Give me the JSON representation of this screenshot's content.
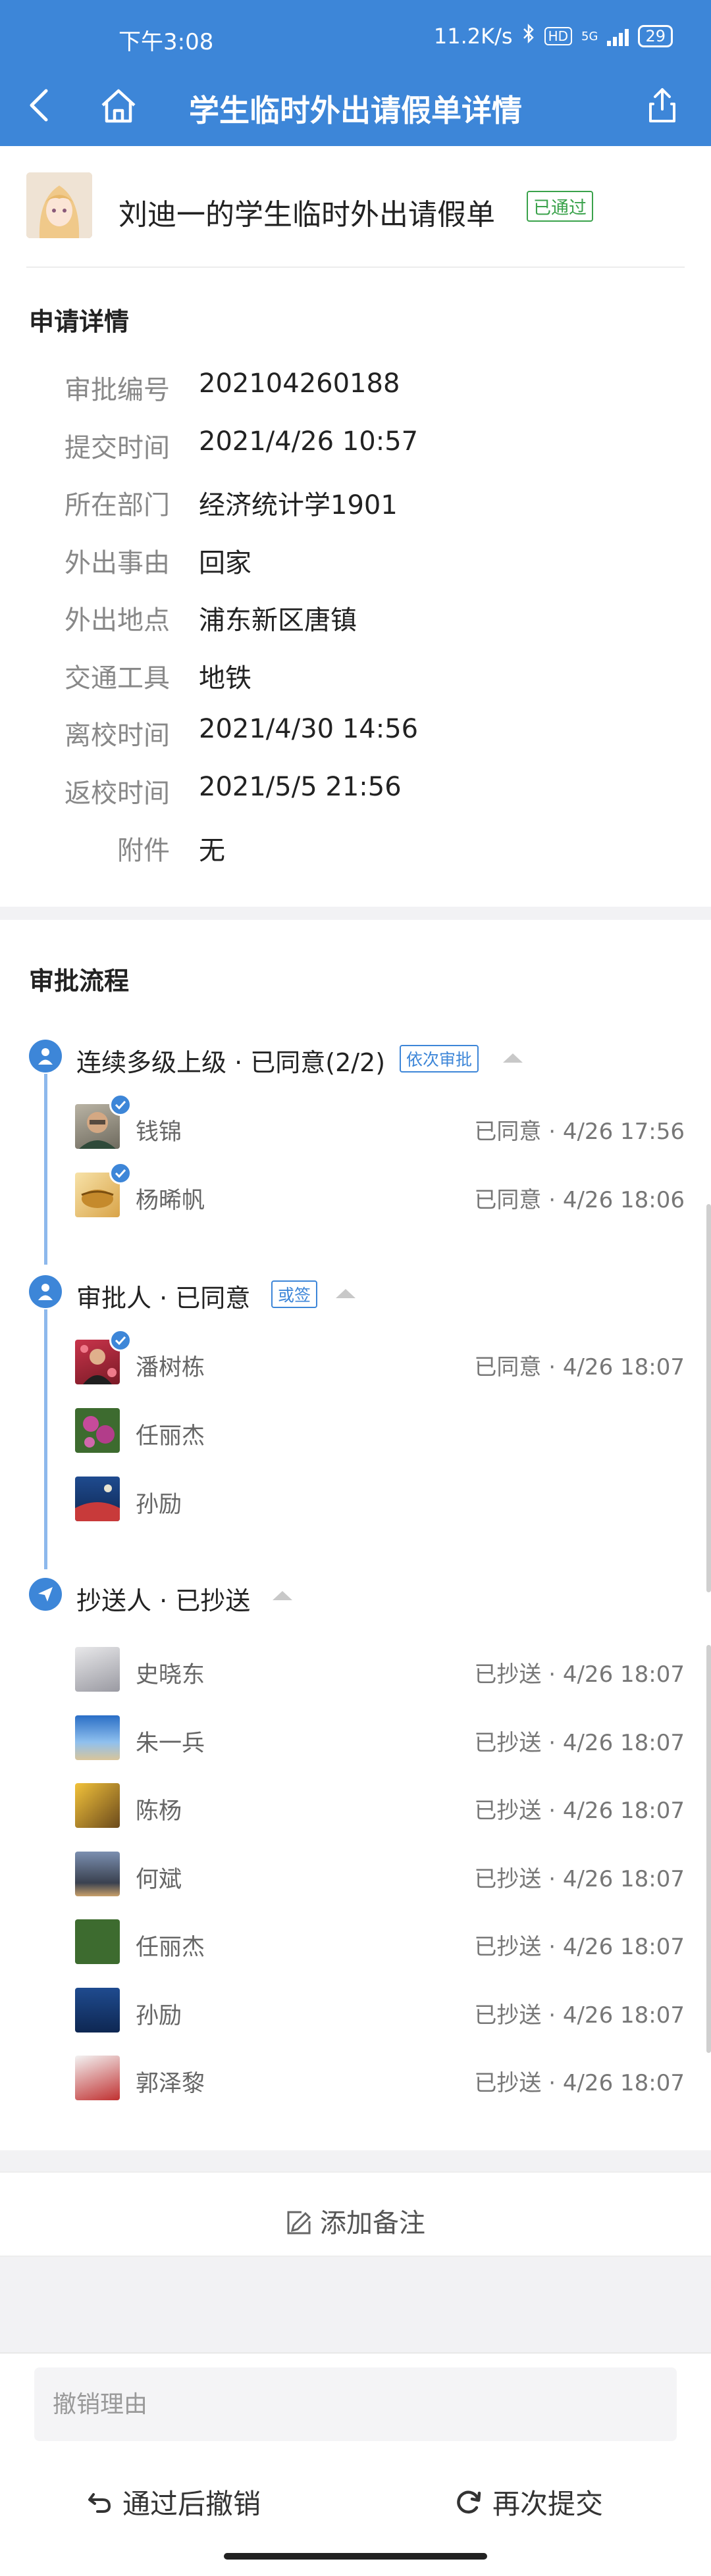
{
  "status_bar": {
    "time": "下午3:08",
    "network": "11.2K/s",
    "hd": "HD",
    "net_type": "5G",
    "battery": "29"
  },
  "header": {
    "title": "学生临时外出请假单详情"
  },
  "request": {
    "title": "刘迪一的学生临时外出请假单",
    "badge": "已通过"
  },
  "details": {
    "section_title": "申请详情",
    "rows": [
      {
        "label": "审批编号",
        "value": "202104260188"
      },
      {
        "label": "提交时间",
        "value": "2021/4/26 10:57"
      },
      {
        "label": "所在部门",
        "value": "经济统计学1901"
      },
      {
        "label": "外出事由",
        "value": "回家"
      },
      {
        "label": "外出地点",
        "value": "浦东新区唐镇"
      },
      {
        "label": "交通工具",
        "value": "地铁"
      },
      {
        "label": "离校时间",
        "value": "2021/4/30 14:56"
      },
      {
        "label": "返校时间",
        "value": "2021/5/5 21:56"
      },
      {
        "label": "附件",
        "value": "无"
      }
    ]
  },
  "flow": {
    "section_title": "审批流程",
    "steps": [
      {
        "title": "连续多级上级 · 已同意(2/2)",
        "tag": "依次审批",
        "icon": "person-icon",
        "people": [
          {
            "name": "钱锦",
            "status": "已同意 · 4/26 17:56",
            "checked": true
          },
          {
            "name": "杨晞帆",
            "status": "已同意 · 4/26 18:06",
            "checked": true
          }
        ]
      },
      {
        "title": "审批人 · 已同意",
        "tag": "或签",
        "icon": "person-icon",
        "people": [
          {
            "name": "潘树栋",
            "status": "已同意 · 4/26 18:07",
            "checked": true
          },
          {
            "name": "任丽杰",
            "status": "",
            "checked": false
          },
          {
            "name": "孙励",
            "status": "",
            "checked": false
          }
        ]
      },
      {
        "title": "抄送人 · 已抄送",
        "tag": "",
        "icon": "send-icon",
        "people": [
          {
            "name": "史晓东",
            "status": "已抄送 · 4/26 18:07"
          },
          {
            "name": "朱一兵",
            "status": "已抄送 · 4/26 18:07"
          },
          {
            "name": "陈杨",
            "status": "已抄送 · 4/26 18:07"
          },
          {
            "name": "何斌",
            "status": "已抄送 · 4/26 18:07"
          },
          {
            "name": "任丽杰",
            "status": "已抄送 · 4/26 18:07"
          },
          {
            "name": "孙励",
            "status": "已抄送 · 4/26 18:07"
          },
          {
            "name": "郭泽黎",
            "status": "已抄送 · 4/26 18:07"
          }
        ]
      }
    ]
  },
  "remark": {
    "label": "添加备注"
  },
  "bottom": {
    "reason_placeholder": "撤销理由",
    "revoke_label": "通过后撤销",
    "resubmit_label": "再次提交"
  },
  "colors": {
    "brand": "#3d86d8",
    "approved": "#3aa24b"
  }
}
